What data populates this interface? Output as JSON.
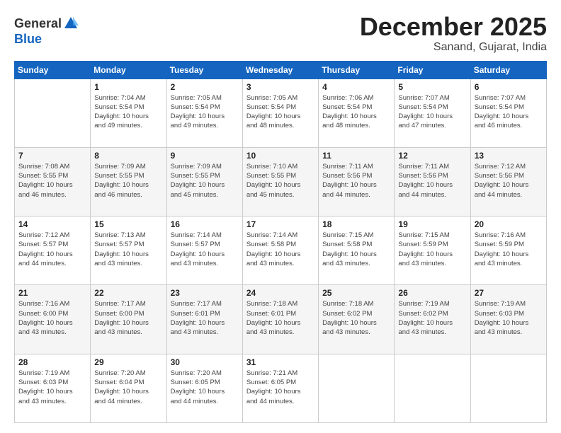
{
  "header": {
    "logo_general": "General",
    "logo_blue": "Blue",
    "month": "December 2025",
    "location": "Sanand, Gujarat, India"
  },
  "weekdays": [
    "Sunday",
    "Monday",
    "Tuesday",
    "Wednesday",
    "Thursday",
    "Friday",
    "Saturday"
  ],
  "rows": [
    {
      "shade": "white",
      "cells": [
        {
          "day": "",
          "info": ""
        },
        {
          "day": "1",
          "info": "Sunrise: 7:04 AM\nSunset: 5:54 PM\nDaylight: 10 hours\nand 49 minutes."
        },
        {
          "day": "2",
          "info": "Sunrise: 7:05 AM\nSunset: 5:54 PM\nDaylight: 10 hours\nand 49 minutes."
        },
        {
          "day": "3",
          "info": "Sunrise: 7:05 AM\nSunset: 5:54 PM\nDaylight: 10 hours\nand 48 minutes."
        },
        {
          "day": "4",
          "info": "Sunrise: 7:06 AM\nSunset: 5:54 PM\nDaylight: 10 hours\nand 48 minutes."
        },
        {
          "day": "5",
          "info": "Sunrise: 7:07 AM\nSunset: 5:54 PM\nDaylight: 10 hours\nand 47 minutes."
        },
        {
          "day": "6",
          "info": "Sunrise: 7:07 AM\nSunset: 5:54 PM\nDaylight: 10 hours\nand 46 minutes."
        }
      ]
    },
    {
      "shade": "shade",
      "cells": [
        {
          "day": "7",
          "info": "Sunrise: 7:08 AM\nSunset: 5:55 PM\nDaylight: 10 hours\nand 46 minutes."
        },
        {
          "day": "8",
          "info": "Sunrise: 7:09 AM\nSunset: 5:55 PM\nDaylight: 10 hours\nand 46 minutes."
        },
        {
          "day": "9",
          "info": "Sunrise: 7:09 AM\nSunset: 5:55 PM\nDaylight: 10 hours\nand 45 minutes."
        },
        {
          "day": "10",
          "info": "Sunrise: 7:10 AM\nSunset: 5:55 PM\nDaylight: 10 hours\nand 45 minutes."
        },
        {
          "day": "11",
          "info": "Sunrise: 7:11 AM\nSunset: 5:56 PM\nDaylight: 10 hours\nand 44 minutes."
        },
        {
          "day": "12",
          "info": "Sunrise: 7:11 AM\nSunset: 5:56 PM\nDaylight: 10 hours\nand 44 minutes."
        },
        {
          "day": "13",
          "info": "Sunrise: 7:12 AM\nSunset: 5:56 PM\nDaylight: 10 hours\nand 44 minutes."
        }
      ]
    },
    {
      "shade": "white",
      "cells": [
        {
          "day": "14",
          "info": "Sunrise: 7:12 AM\nSunset: 5:57 PM\nDaylight: 10 hours\nand 44 minutes."
        },
        {
          "day": "15",
          "info": "Sunrise: 7:13 AM\nSunset: 5:57 PM\nDaylight: 10 hours\nand 43 minutes."
        },
        {
          "day": "16",
          "info": "Sunrise: 7:14 AM\nSunset: 5:57 PM\nDaylight: 10 hours\nand 43 minutes."
        },
        {
          "day": "17",
          "info": "Sunrise: 7:14 AM\nSunset: 5:58 PM\nDaylight: 10 hours\nand 43 minutes."
        },
        {
          "day": "18",
          "info": "Sunrise: 7:15 AM\nSunset: 5:58 PM\nDaylight: 10 hours\nand 43 minutes."
        },
        {
          "day": "19",
          "info": "Sunrise: 7:15 AM\nSunset: 5:59 PM\nDaylight: 10 hours\nand 43 minutes."
        },
        {
          "day": "20",
          "info": "Sunrise: 7:16 AM\nSunset: 5:59 PM\nDaylight: 10 hours\nand 43 minutes."
        }
      ]
    },
    {
      "shade": "shade",
      "cells": [
        {
          "day": "21",
          "info": "Sunrise: 7:16 AM\nSunset: 6:00 PM\nDaylight: 10 hours\nand 43 minutes."
        },
        {
          "day": "22",
          "info": "Sunrise: 7:17 AM\nSunset: 6:00 PM\nDaylight: 10 hours\nand 43 minutes."
        },
        {
          "day": "23",
          "info": "Sunrise: 7:17 AM\nSunset: 6:01 PM\nDaylight: 10 hours\nand 43 minutes."
        },
        {
          "day": "24",
          "info": "Sunrise: 7:18 AM\nSunset: 6:01 PM\nDaylight: 10 hours\nand 43 minutes."
        },
        {
          "day": "25",
          "info": "Sunrise: 7:18 AM\nSunset: 6:02 PM\nDaylight: 10 hours\nand 43 minutes."
        },
        {
          "day": "26",
          "info": "Sunrise: 7:19 AM\nSunset: 6:02 PM\nDaylight: 10 hours\nand 43 minutes."
        },
        {
          "day": "27",
          "info": "Sunrise: 7:19 AM\nSunset: 6:03 PM\nDaylight: 10 hours\nand 43 minutes."
        }
      ]
    },
    {
      "shade": "white",
      "cells": [
        {
          "day": "28",
          "info": "Sunrise: 7:19 AM\nSunset: 6:03 PM\nDaylight: 10 hours\nand 43 minutes."
        },
        {
          "day": "29",
          "info": "Sunrise: 7:20 AM\nSunset: 6:04 PM\nDaylight: 10 hours\nand 44 minutes."
        },
        {
          "day": "30",
          "info": "Sunrise: 7:20 AM\nSunset: 6:05 PM\nDaylight: 10 hours\nand 44 minutes."
        },
        {
          "day": "31",
          "info": "Sunrise: 7:21 AM\nSunset: 6:05 PM\nDaylight: 10 hours\nand 44 minutes."
        },
        {
          "day": "",
          "info": ""
        },
        {
          "day": "",
          "info": ""
        },
        {
          "day": "",
          "info": ""
        }
      ]
    }
  ]
}
